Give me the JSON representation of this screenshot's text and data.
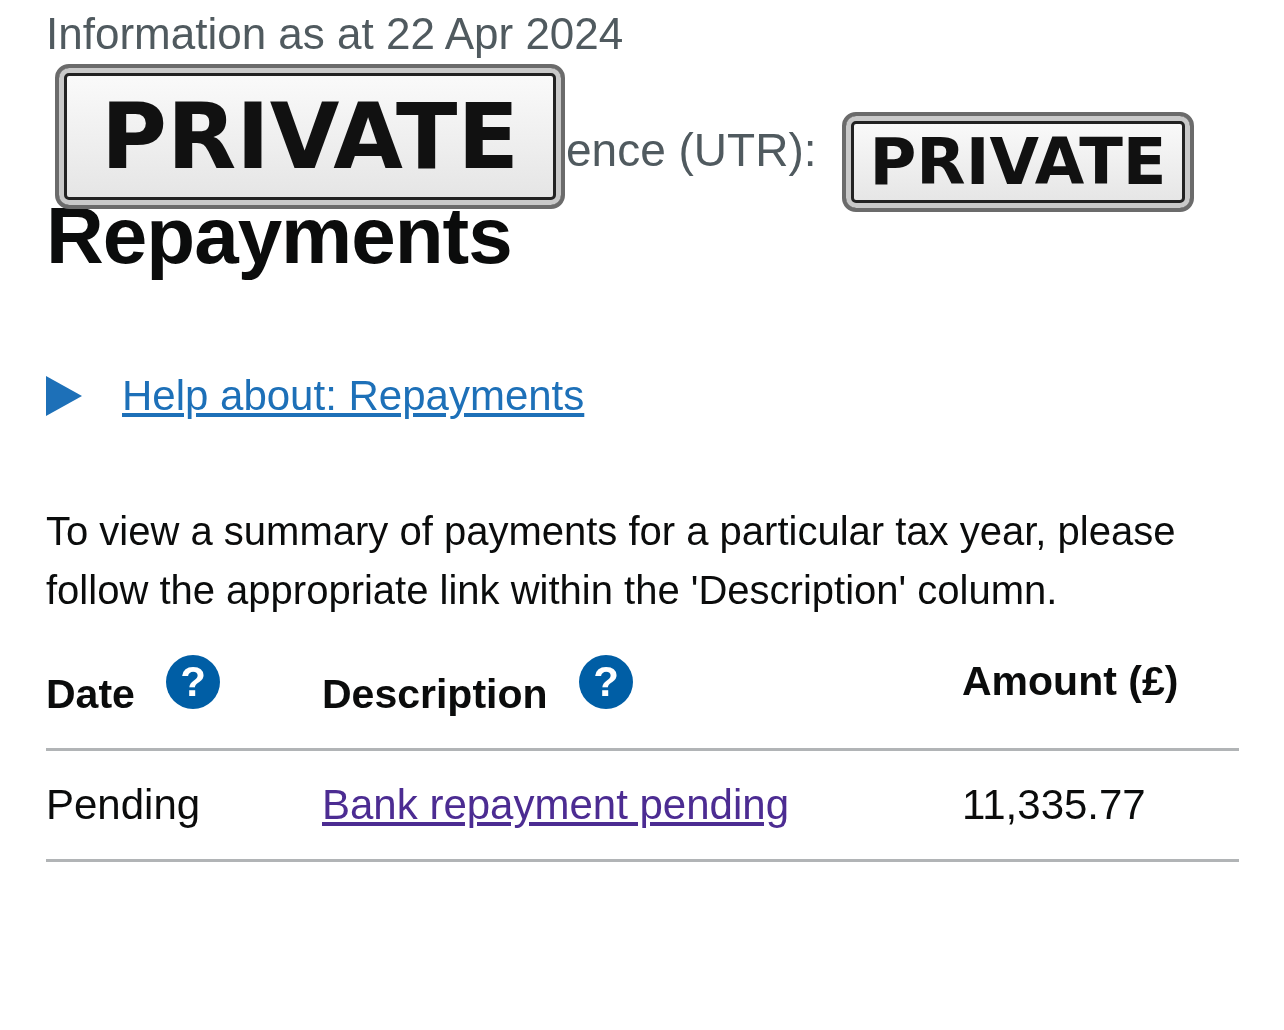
{
  "info_line": "Information as at 22 Apr 2024",
  "utr_line": "ence (UTR):",
  "stickers": [
    {
      "text": "PRIVATE"
    },
    {
      "text": "PRIVATE"
    }
  ],
  "heading": "Repayments",
  "help_link": "Help about: Repayments",
  "intro": "To view a summary of payments for a particular tax year, please follow the appropriate link within the 'Description' column.",
  "table": {
    "columns": [
      {
        "label": "Date",
        "help": "?"
      },
      {
        "label": "Description",
        "help": "?"
      },
      {
        "label": "Amount (£)"
      }
    ],
    "rows": [
      {
        "date": "Pending",
        "description": "Bank repayment pending",
        "visited": true,
        "amount": "11,335.77"
      }
    ]
  }
}
